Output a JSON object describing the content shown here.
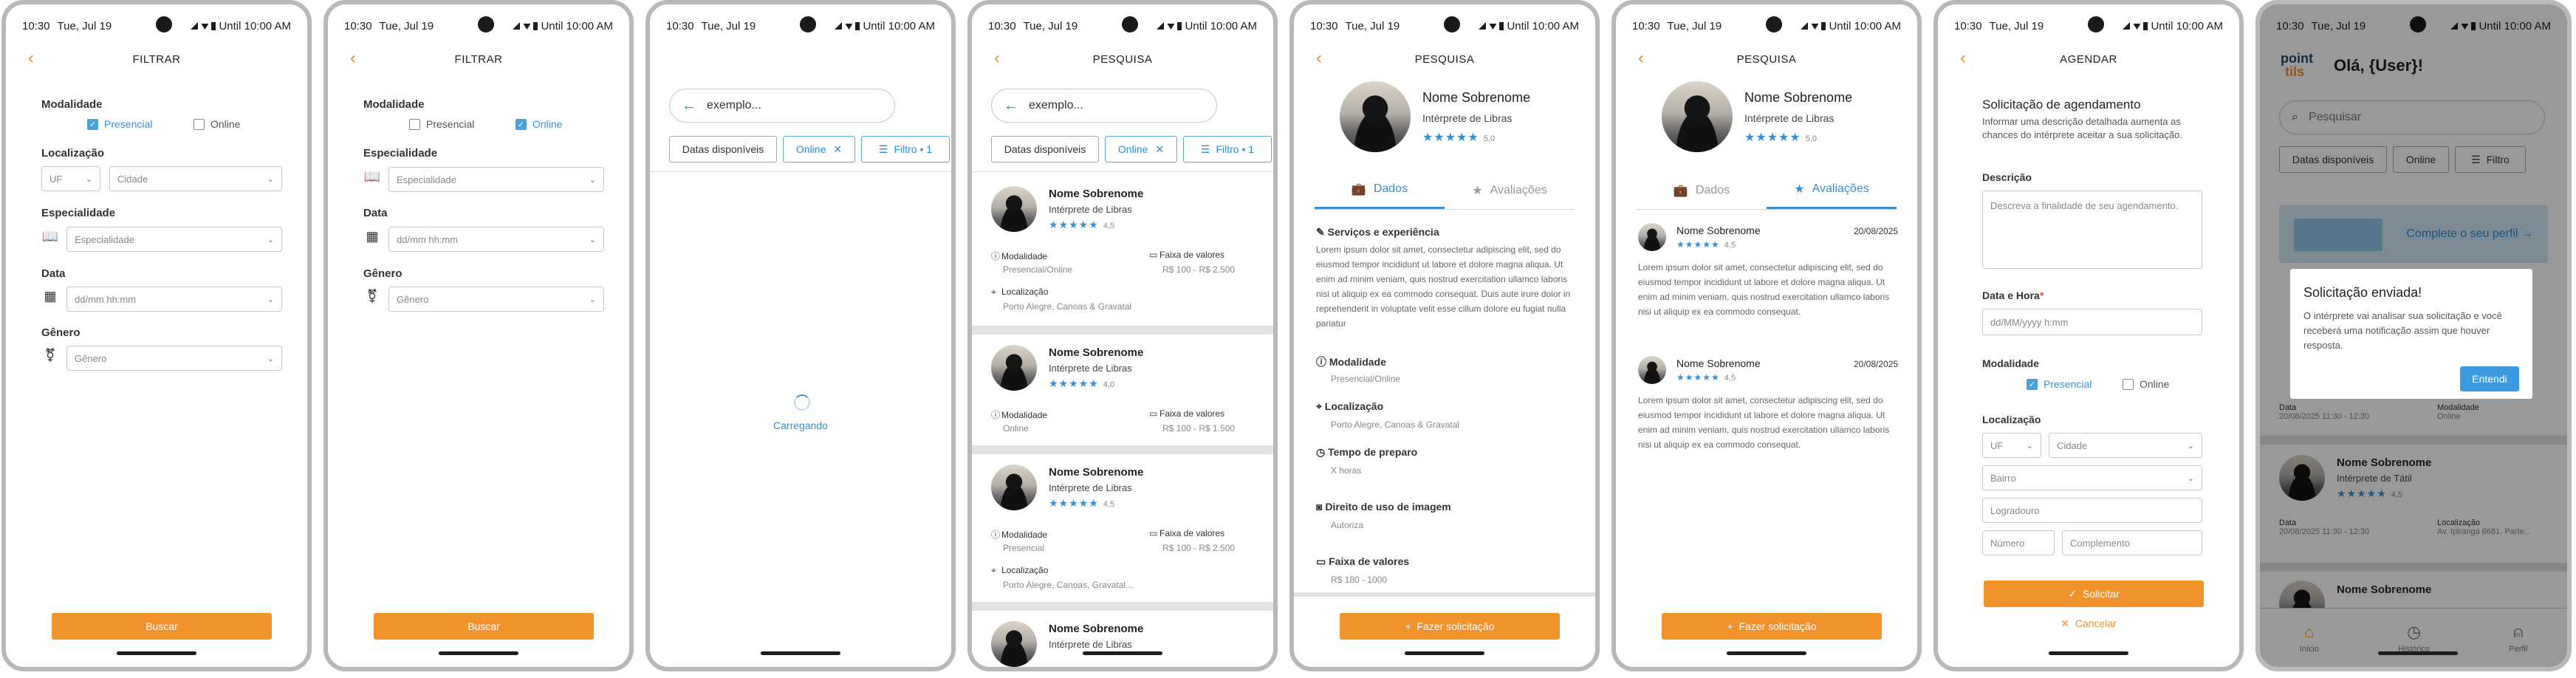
{
  "status": {
    "time": "10:30",
    "date": "Tue, Jul 19",
    "battery": "Until 10:00 AM"
  },
  "filter": {
    "title": "FILTRAR",
    "modalidade": "Modalidade",
    "presencial": "Presencial",
    "online": "Online",
    "localizacao": "Localização",
    "uf": "UF",
    "cidade": "Cidade",
    "especialidade": "Especialidade",
    "especialidade_ph": "Especialidade",
    "data": "Data",
    "data_ph": "dd/mm hh:mm",
    "genero": "Gênero",
    "genero_ph": "Gênero",
    "buscar": "Buscar"
  },
  "search": {
    "query": "exemplo...",
    "chips": {
      "datas": "Datas disponíveis",
      "online": "Online",
      "filtro": "Filtro • 1"
    },
    "loading": "Carregando",
    "title": "PESQUISA"
  },
  "results": [
    {
      "name": "Nome Sobrenome",
      "role": "Intérprete de Libras",
      "rating": "4,5",
      "modalidade": "Modalidade",
      "modalidade_val": "Presencial/Online",
      "faixa": "Faixa de valores",
      "faixa_val": "R$ 100 - R$ 2.500",
      "loc": "Localização",
      "loc_val": "Porto Alegre, Canoas & Gravatal"
    },
    {
      "name": "Nome Sobrenome",
      "role": "Intérprete de Libras",
      "rating": "4,0",
      "modalidade": "Modalidade",
      "modalidade_val": "Online",
      "faixa": "Faixa de valores",
      "faixa_val": "R$ 100 - R$ 1.500"
    },
    {
      "name": "Nome Sobrenome",
      "role": "Intérprete de Libras",
      "rating": "4,5",
      "modalidade": "Modalidade",
      "modalidade_val": "Presencial",
      "faixa": "Faixa de valores",
      "faixa_val": "R$ 100 - R$ 2.500",
      "loc": "Localização",
      "loc_val": "Porto Alegre, Canoas, Gravatal..."
    },
    {
      "name": "Nome Sobrenome",
      "role": "Intérprete de Libras"
    }
  ],
  "profile": {
    "name": "Nome Sobrenome",
    "role": "Intérprete de Libras",
    "rating": "5,0",
    "tab_dados": "Dados",
    "tab_aval": "Avaliações",
    "servicos": "Serviços e experiência",
    "lorem": "Lorem ipsum dolor sit amet, consectetur adipiscing elit, sed do eiusmod tempor incididunt ut labore et dolore magna aliqua. Ut enim ad minim veniam, quis nostrud exercitation ullamco laboris nisi ut aliquip ex ea commodo consequat. Duis aute irure dolor in reprehenderit in voluptate velit esse cillum dolore eu fugiat nulla pariatur",
    "modalidade": "Modalidade",
    "modalidade_val": "Presencial/Online",
    "localizacao": "Localização",
    "localizacao_val": "Porto Alegre, Canoas & Gravatal",
    "tempo": "Tempo de preparo",
    "tempo_val": "X horas",
    "direito": "Direito de uso de imagem",
    "direito_val": "Autoriza",
    "faixa": "Faixa de valores",
    "faixa_val": "R$ 180 - 1000",
    "fazer": "Fazer solicitação"
  },
  "reviews": [
    {
      "name": "Nome Sobrenome",
      "rating": "4,5",
      "date": "20/08/2025",
      "text": "Lorem ipsum dolor sit amet, consectetur adipiscing elit, sed do eiusmod tempor incididunt ut labore et dolore magna aliqua. Ut enim ad minim veniam, quis nostrud exercitation ullamco laboris nisi ut aliquip ex ea commodo consequat."
    },
    {
      "name": "Nome Sobrenome",
      "rating": "4,5",
      "date": "20/08/2025",
      "text": "Lorem ipsum dolor sit amet, consectetur adipiscing elit, sed do eiusmod tempor incididunt ut labore et dolore magna aliqua. Ut enim ad minim veniam, quis nostrud exercitation ullamco laboris nisi ut aliquip ex ea commodo consequat."
    }
  ],
  "agendar": {
    "title": "AGENDAR",
    "heading": "Solicitação de agendamento",
    "hint": "Informar uma descrição detalhada aumenta as chances do intérprete aceitar a sua solicitação.",
    "descricao": "Descrição",
    "descricao_ph": "Descreva a finalidade de seu agendamento.",
    "datahora": "Data e Hora",
    "datahora_ph": "dd/MM/yyyy h:mm",
    "modalidade": "Modalidade",
    "presencial": "Presencial",
    "online": "Online",
    "localizacao": "Localização",
    "uf": "UF",
    "cidade": "Cidade",
    "bairro": "Bairro",
    "logradouro": "Logradouro",
    "numero": "Número",
    "complemento": "Complemento",
    "solicitar": "Solicitar",
    "cancelar": "Cancelar"
  },
  "home": {
    "greeting": "Olá, {User}!",
    "logo1": "point",
    "logo2": "tils",
    "search_ph": "Pesquisar",
    "chip1": "Datas disponíveis",
    "chip2": "Online",
    "chip3": "Filtro",
    "banner": "Complete o seu perfil →",
    "dialog_title": "Solicitação enviada!",
    "dialog_text": "O intérprete vai analisar sua solicitação e você receberá uma notificação assim que houver resposta.",
    "dialog_btn": "Entendi",
    "data_lbl": "Data",
    "data_val": "20/08/2025 11:30 - 12:30",
    "mod_lbl": "Modalidade",
    "mod_val": "Online",
    "card2_name": "Nome Sobrenome",
    "card2_role": "Intérprete de Tátil",
    "card2_rating": "4,5",
    "card2_data_val": "20/08/2025 11:30 - 12:30",
    "card2_loc_lbl": "Localização",
    "card2_loc_val": "Av. Ipiranga 6681, Parte...",
    "card3_name": "Nome Sobrenome",
    "nav": {
      "inicio": "Início",
      "historico": "Histórico",
      "perfil": "Perfil"
    }
  }
}
